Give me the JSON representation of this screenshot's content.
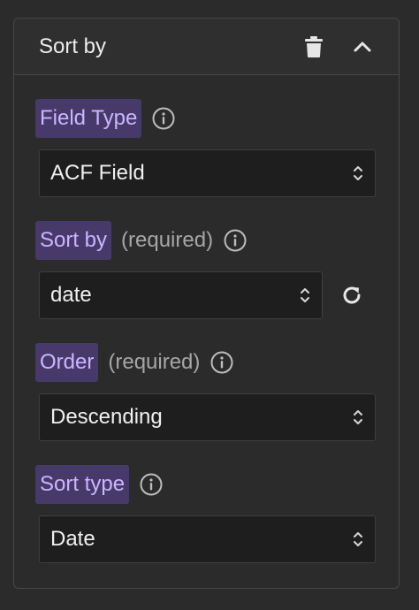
{
  "panel": {
    "title": "Sort by",
    "trash_icon": "trash-icon",
    "collapse_icon": "chevron-up-icon"
  },
  "fields": {
    "field_type": {
      "label": "Field Type",
      "value": "ACF Field"
    },
    "sort_by": {
      "label": "Sort by",
      "required": "(required)",
      "value": "date"
    },
    "order": {
      "label": "Order",
      "required": "(required)",
      "value": "Descending"
    },
    "sort_type": {
      "label": "Sort type",
      "value": "Date"
    }
  },
  "colors": {
    "label_chip_bg": "#473a6b",
    "label_chip_text": "#c9b6ff",
    "select_bg": "#1e1e1e",
    "panel_bg": "#2b2b2b"
  }
}
